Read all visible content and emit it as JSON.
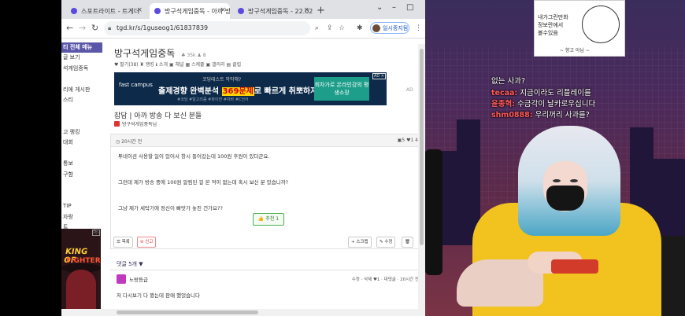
{
  "browser": {
    "tabs": [
      {
        "label": "스포트라이트 - 트게더"
      },
      {
        "label": "방구석게임중독 - 아까 방"
      },
      {
        "label": "방구석게임중독 - 22.02."
      }
    ],
    "url": "tgd.kr/s/1guseog1/61837839",
    "profile_label": "일시중지됨"
  },
  "sidebar": {
    "header": "티 전체 메뉴",
    "items": [
      "글 보기",
      "석게임중독",
      "",
      "리에 게시판",
      "스티",
      "",
      "",
      "고 랭킹",
      "대회",
      "",
      "통보",
      "구함",
      "",
      "",
      "TIP",
      "자랑",
      "트",
      "신고"
    ],
    "ad_title": "KING OF",
    "ad_subtitle": "FIGHTER"
  },
  "board": {
    "title": "방구석게임중독",
    "stats": "♣ 35k  ♟ 8",
    "meta": "♥ 팔기(38)   ♜ 랭킹   ℹ 소개   ▣ 채널   ▦ 스케줄   ▣ 갤러리   ▤ 클립"
  },
  "ad": {
    "logo": "fast campus",
    "small": "코딩테스트 막막해?",
    "big_pre": "출제경향 완벽분석",
    "big_highlight": "369문제",
    "big_post": "로 빠르게 취뽀하자!",
    "tags": "#코딩  #알고리즘  #파이썬  #자바  #C언어",
    "cta": "회차가로 온라인강의 평생소장",
    "label": "AD"
  },
  "post": {
    "title": "잡담 | 아까 방송 다 보신 분들",
    "author": "방구석게임중독님",
    "time": "20시간 전",
    "counts": "▣5  ♥1  4",
    "lines": [
      "투네이션 사용할 일이 있어서 창시 들어갔는데 100원 후원이 있더군요.",
      "그런데 제가 방송 중에 100원 알림된 걸 본 적이 없는데 혹시 보신 분 있습니까?",
      "그냥 제가 세탁기에 정신이 빠맛가 놓친 건가요??"
    ],
    "recommend": "👍 추천 1",
    "actions": {
      "list": "목록",
      "report": "신고",
      "scrap": "스크랩",
      "edit": "수정"
    }
  },
  "comments": {
    "header": "댓글 5개 ▼",
    "items": [
      {
        "author": "노랑등급",
        "controls": "수정 · 삭제  ♥1 · 대댓글 · 20시간 전",
        "text": "저 다시보기 다 봤는데 판매 했었습니다"
      }
    ]
  },
  "stream": {
    "memo": "내가그린만화\n정보란에서\n볼수있음",
    "memo_sig": "~ 향고 아님 ~",
    "chat": [
      {
        "name": "",
        "msg": "없는 사과?"
      },
      {
        "name": "tecaa:",
        "msg": "지금이라도 리플레이를"
      },
      {
        "name": "윤종혁:",
        "msg": "수금각이 날카로우십니다"
      },
      {
        "name": "shm0888:",
        "msg": "우리꺼리 사과를?"
      }
    ]
  }
}
